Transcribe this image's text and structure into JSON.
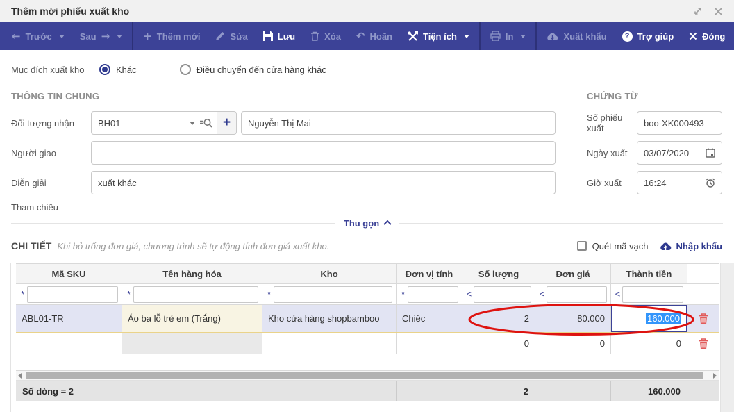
{
  "window": {
    "title": "Thêm mới phiếu xuất kho"
  },
  "colors": {
    "brand": "#3c4297",
    "toolbar_disabled": "#9097c9",
    "selection_highlight": "#3295fb",
    "annotation": "#de1310",
    "danger": "#e15b5b",
    "selected_row": "#e2e4f3",
    "edited_cell": "#f8f4e3"
  },
  "icons": {
    "arrow_left": "←",
    "arrow_right": "→",
    "plus": "+",
    "undo": "↶",
    "question": "?"
  },
  "toolbar": {
    "prev": "Trước",
    "next": "Sau",
    "add": "Thêm mới",
    "edit": "Sửa",
    "save": "Lưu",
    "delete": "Xóa",
    "undo": "Hoãn",
    "utilities": "Tiện ích",
    "print": "In",
    "export": "Xuất khẩu",
    "help": "Trợ giúp",
    "close": "Đóng"
  },
  "purpose": {
    "label": "Mục đích xuất kho",
    "options": [
      {
        "label": "Khác",
        "selected": true
      },
      {
        "label": "Điều chuyển đến cửa hàng khác",
        "selected": false
      }
    ]
  },
  "general": {
    "title": "THÔNG TIN CHUNG",
    "receiver_label": "Đối tượng nhận",
    "receiver_code": "BH01",
    "receiver_name": "Nguyễn Thị Mai",
    "deliverer_label": "Người giao",
    "deliverer_value": "",
    "description_label": "Diễn giải",
    "description_value": "xuất khác",
    "reference_label": "Tham chiếu"
  },
  "document": {
    "title": "CHỨNG TỪ",
    "number_label": "Số phiếu xuất",
    "number_value": "boo-XK000493",
    "date_label": "Ngày xuất",
    "date_value": "03/07/2020",
    "time_label": "Giờ xuất",
    "time_value": "16:24"
  },
  "collapse": {
    "label": "Thu gọn"
  },
  "details": {
    "title": "CHI TIẾT",
    "hint": "Khi bỏ trống đơn giá, chương trình sẽ tự động tính đơn giá xuất kho.",
    "barcode_label": "Quét mã vạch",
    "import_label": "Nhập khẩu",
    "columns": [
      {
        "label": "Mã SKU",
        "filter": "*"
      },
      {
        "label": "Tên hàng hóa",
        "filter": "*"
      },
      {
        "label": "Kho",
        "filter": "*"
      },
      {
        "label": "Đơn vị tính",
        "filter": "*"
      },
      {
        "label": "Số lượng",
        "filter": "≤"
      },
      {
        "label": "Đơn giá",
        "filter": "≤"
      },
      {
        "label": "Thành tiền",
        "filter": "≤"
      }
    ],
    "rows": [
      {
        "sku": "ABL01-TR",
        "name": "Áo ba lỗ trẻ em (Trắng)",
        "warehouse": "Kho cửa hàng shopbamboo",
        "unit": "Chiếc",
        "quantity": "2",
        "unit_price": "80.000",
        "amount": "160.000"
      },
      {
        "sku": "",
        "name": "",
        "warehouse": "",
        "unit": "",
        "quantity": "0",
        "unit_price": "0",
        "amount": "0"
      }
    ],
    "footer": {
      "row_count": "Số dòng = 2",
      "total_quantity": "2",
      "total_amount": "160.000"
    }
  }
}
